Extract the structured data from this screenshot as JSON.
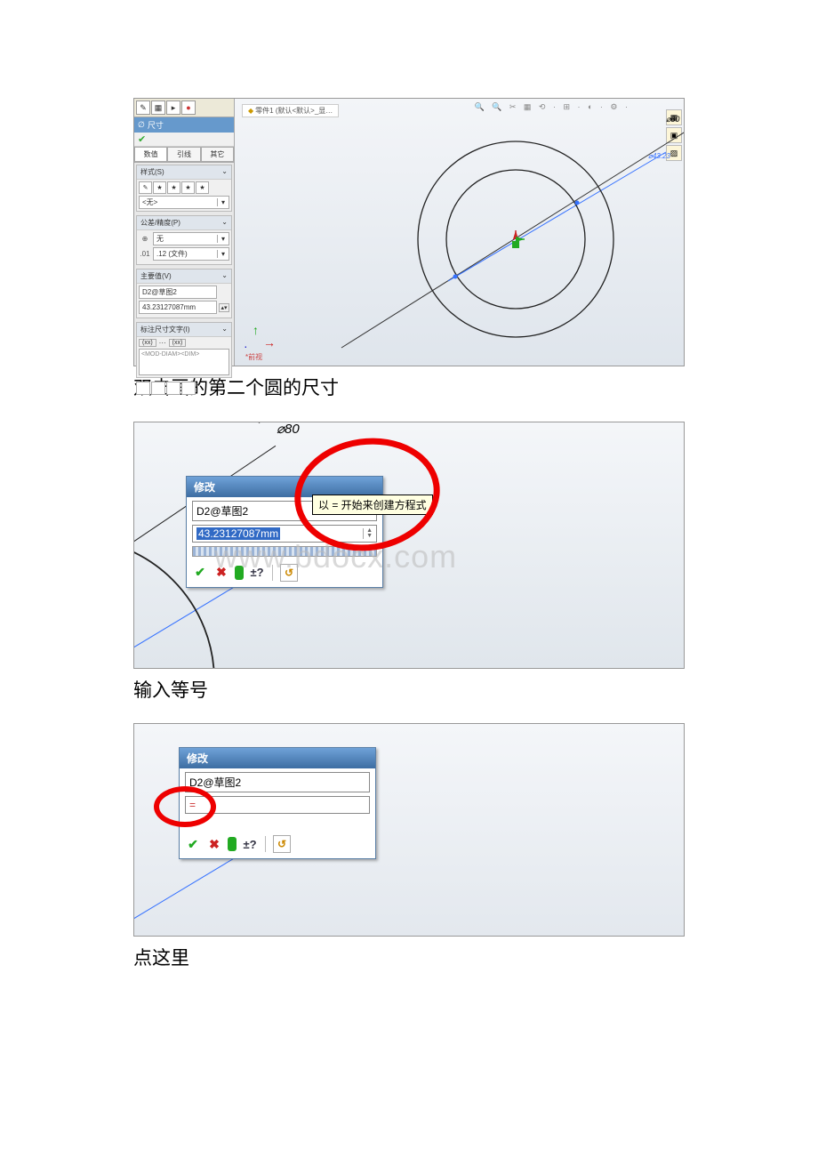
{
  "captions": {
    "c1": "双击画的第二个圆的尺寸",
    "c2": "输入等号",
    "c3": "点这里"
  },
  "fig1": {
    "panel": {
      "title": "尺寸",
      "tabs": {
        "a": "数值",
        "b": "引线",
        "c": "其它"
      },
      "style": {
        "title": "样式(S)",
        "select": "<无>"
      },
      "tol": {
        "title": "公差/精度(P)",
        "v1": "无",
        "v2": ".12 (文件)"
      },
      "prim": {
        "title": "主要值(V)",
        "name": "D2@草图2",
        "value": "43.23127087mm"
      },
      "dimtext": {
        "title": "标注尺寸文字(I)",
        "placeholder": "<MOD-DIAM><DIM>"
      }
    },
    "canvas": {
      "doc": "零件1   (默认<默认>_显…",
      "dim1": "⌀80",
      "dim2": "⌀43.23",
      "view": "*前视"
    }
  },
  "fig2": {
    "title": "修改",
    "name": "D2@草图2",
    "value": "43.23127087mm",
    "tooltip": "以 = 开始来创建方程式",
    "dim": "⌀80",
    "watermark": "www.bdocx.com",
    "actions": {
      "ok": "✔",
      "cancel": "✖",
      "rebuild": "⬤",
      "pm": "±?",
      "reset": "↺"
    }
  },
  "fig3": {
    "title": "修改",
    "name": "D2@草图2",
    "value": "=",
    "actions": {
      "ok": "✔",
      "cancel": "✖",
      "rebuild": "⬤",
      "pm": "±?",
      "reset": "↺"
    }
  }
}
